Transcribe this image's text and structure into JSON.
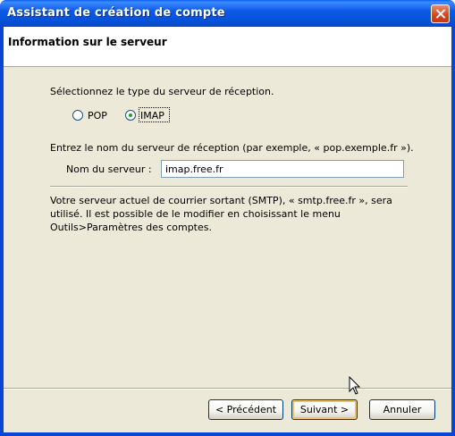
{
  "window": {
    "title": "Assistant de création de compte"
  },
  "header": {
    "title": "Information sur le serveur"
  },
  "server_type": {
    "prompt": "Sélectionnez le type du serveur de réception.",
    "options": [
      {
        "label": "POP",
        "selected": false
      },
      {
        "label": "IMAP",
        "selected": true
      }
    ]
  },
  "incoming": {
    "prompt": "Entrez le nom du serveur de réception (par exemple, « pop.exemple.fr »).",
    "field_label": "Nom du serveur :",
    "field_value": "imap.free.fr"
  },
  "smtp_note": {
    "lines": [
      "Votre serveur actuel de courrier sortant (SMTP), « smtp.free.fr », sera",
      "utilisé. Il est possible de le modifier en choisissant le menu",
      "Outils>Paramètres des comptes."
    ]
  },
  "buttons": {
    "back": "< Précédent",
    "next": "Suivant >",
    "cancel": "Annuler"
  }
}
